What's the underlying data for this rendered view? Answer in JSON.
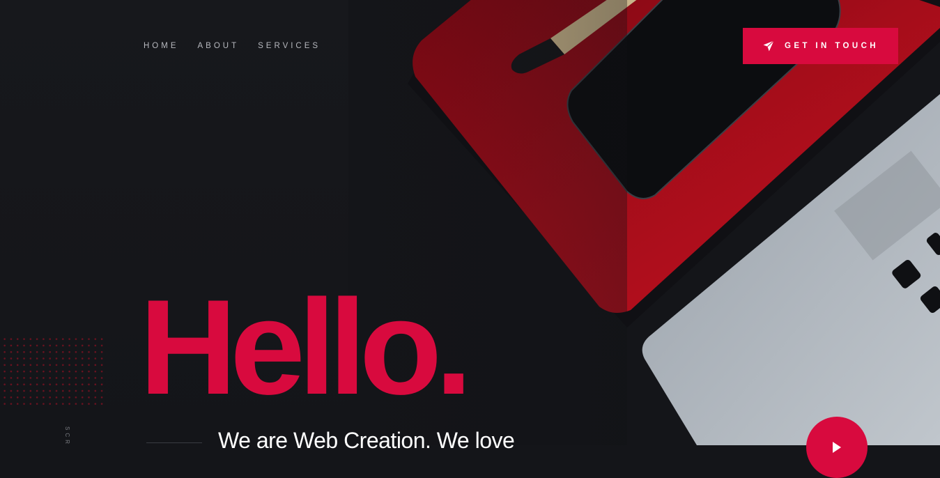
{
  "nav": {
    "items": [
      {
        "label": "HOME"
      },
      {
        "label": "ABOUT"
      },
      {
        "label": "SERVICES"
      }
    ]
  },
  "cta": {
    "label": "GET IN TOUCH",
    "icon": "paper-plane-icon"
  },
  "hero": {
    "title": "Hello.",
    "subtitle": "We are Web Creation. We love",
    "scroll_label": "SCR"
  },
  "video": {
    "icon": "play-icon"
  },
  "colors": {
    "accent": "#d80a3e",
    "background": "#141519",
    "nav_text": "#b7b9bf",
    "subtitle_text": "#ffffff"
  }
}
